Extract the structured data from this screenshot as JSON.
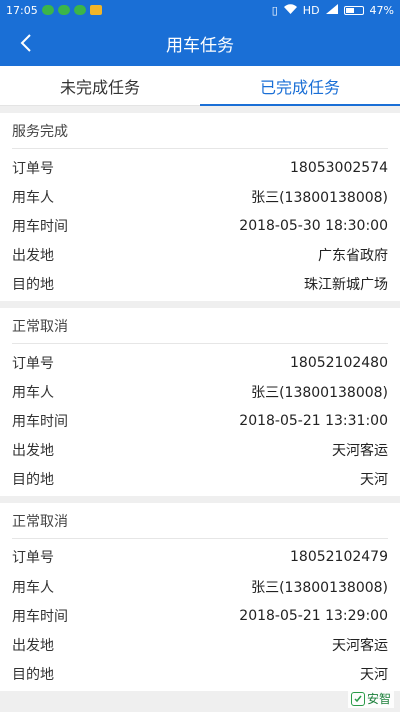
{
  "status_bar": {
    "time": "17:05",
    "network": "HD",
    "battery": "47%"
  },
  "header": {
    "title": "用车任务"
  },
  "tabs": [
    {
      "label": "未完成任务"
    },
    {
      "label": "已完成任务"
    }
  ],
  "labels": {
    "order_no": "订单号",
    "user": "用车人",
    "time": "用车时间",
    "origin": "出发地",
    "destination": "目的地"
  },
  "orders": [
    {
      "status": "服务完成",
      "order_no": "18053002574",
      "user": "张三(13800138008)",
      "time": "2018-05-30 18:30:00",
      "origin": "广东省政府",
      "destination": "珠江新城广场"
    },
    {
      "status": "正常取消",
      "order_no": "18052102480",
      "user": "张三(13800138008)",
      "time": "2018-05-21 13:31:00",
      "origin": "天河客运",
      "destination": "天河"
    },
    {
      "status": "正常取消",
      "order_no": "18052102479",
      "user": "张三(13800138008)",
      "time": "2018-05-21 13:29:00",
      "origin": "天河客运",
      "destination": "天河"
    }
  ],
  "watermark": {
    "text": "安智"
  }
}
